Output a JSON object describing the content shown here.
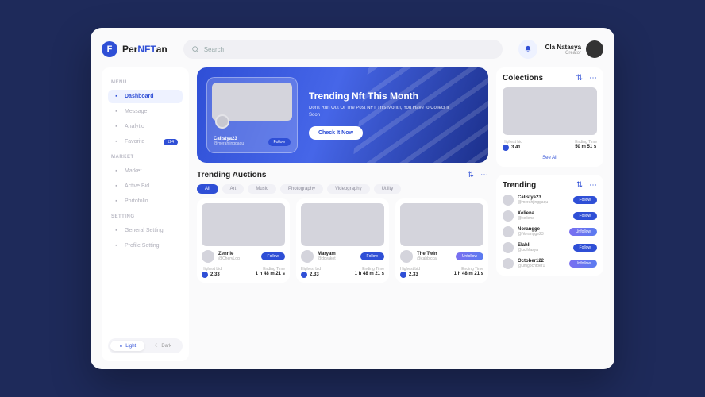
{
  "brand": {
    "badge": "F",
    "name_pre": "Per",
    "name_mid": "NFT",
    "name_post": "an"
  },
  "search": {
    "placeholder": "Search"
  },
  "user": {
    "name": "Cla Natasya",
    "role": "Creator"
  },
  "sidebar": {
    "sections": [
      {
        "label": "MENU",
        "items": [
          {
            "icon": "grid",
            "label": "Dashboard",
            "active": true
          },
          {
            "icon": "message",
            "label": "Message"
          },
          {
            "icon": "chart",
            "label": "Analytic"
          },
          {
            "icon": "heart",
            "label": "Favorite",
            "badge": "124"
          }
        ]
      },
      {
        "label": "MARKET",
        "items": [
          {
            "icon": "store",
            "label": "Market"
          },
          {
            "icon": "bid",
            "label": "Active Bid"
          },
          {
            "icon": "portfolio",
            "label": "Portofolio"
          }
        ]
      },
      {
        "label": "SETTING",
        "items": [
          {
            "icon": "gear",
            "label": "General Setting"
          },
          {
            "icon": "profile",
            "label": "Profile Setting"
          }
        ]
      }
    ],
    "theme": {
      "light": "Light",
      "dark": "Dark"
    }
  },
  "hero": {
    "title": "Trending Nft This Month",
    "subtitle": "Don't Run Out Of The Post NFT This Month, You Have to Collect It Soon",
    "cta": "Check It Now",
    "creator": {
      "name": "Calistya23",
      "handle": "@merahjinggaqu",
      "action": "Follow"
    }
  },
  "auctions": {
    "title": "Trending Auctions",
    "tabs": [
      "All",
      "Art",
      "Music",
      "Photography",
      "Videography",
      "Utility"
    ],
    "active_tab": 0,
    "items": [
      {
        "name": "Zennie",
        "handle": "@CheryLoq",
        "action": "Follow",
        "action_type": "follow",
        "bid_label": "Highest bid",
        "bid": "2.33",
        "time_label": "Ending Time",
        "time": "1 h 48 m 21 s"
      },
      {
        "name": "Maryam",
        "handle": "@doyakot",
        "action": "Follow",
        "action_type": "follow",
        "bid_label": "Highest bid",
        "bid": "2.33",
        "time_label": "Ending Time",
        "time": "1 h 48 m 21 s"
      },
      {
        "name": "The Twin",
        "handle": "@cabbicca",
        "action": "Unfollow",
        "action_type": "unfollow",
        "bid_label": "Highest bid",
        "bid": "2.33",
        "time_label": "Ending Time",
        "time": "1 h 48 m 21 s"
      }
    ]
  },
  "collections": {
    "title": "Colections",
    "bid_label": "Highest bid",
    "bid": "3.41",
    "time_label": "Ending Time",
    "time": "50 m 51 s",
    "see_all": "See All"
  },
  "trending": {
    "title": "Trending",
    "items": [
      {
        "name": "Calistya23",
        "handle": "@merahjinggaqu",
        "action": "Follow",
        "type": "follow"
      },
      {
        "name": "Xeliena",
        "handle": "@xeliena",
        "action": "Follow",
        "type": "follow"
      },
      {
        "name": "Norangge",
        "handle": "@Norangge23",
        "action": "Unfollow",
        "type": "unfollow"
      },
      {
        "name": "Elahli",
        "handle": "@ucihlasya",
        "action": "Follow",
        "type": "follow"
      },
      {
        "name": "October122",
        "handle": "@umgochtber1",
        "action": "Unfollow",
        "type": "unfollow"
      }
    ]
  }
}
